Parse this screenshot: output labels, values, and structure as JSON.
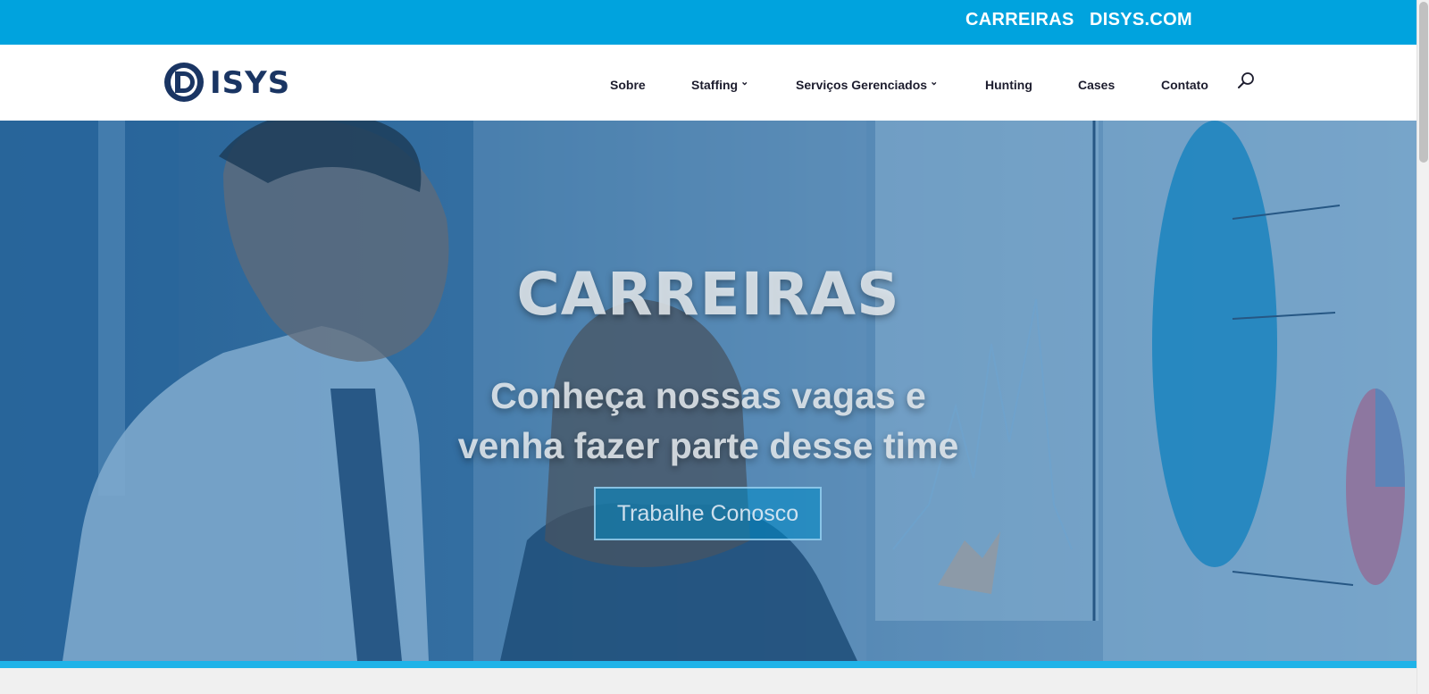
{
  "topbar": {
    "links": [
      "CARREIRAS",
      "DISYS.COM"
    ],
    "color": "#00a3de"
  },
  "header": {
    "logo_text": "DISYS",
    "nav": [
      {
        "label": "Sobre",
        "has_dropdown": false
      },
      {
        "label": "Staffing",
        "has_dropdown": true
      },
      {
        "label": "Serviços Gerenciados",
        "has_dropdown": true
      },
      {
        "label": "Hunting",
        "has_dropdown": false
      },
      {
        "label": "Cases",
        "has_dropdown": false
      },
      {
        "label": "Contato",
        "has_dropdown": false
      }
    ],
    "search_icon": "search-icon",
    "chevron": "⌄"
  },
  "hero": {
    "title": "CARREIRAS",
    "subtitle_line1": "Conheça nossas vagas e",
    "subtitle_line2": "venha fazer parte desse time",
    "button_label": "Trabalhe Conosco"
  },
  "colors": {
    "brand_blue": "#00a3de",
    "logo_navy": "#1a3563",
    "strip": "#1fb3e8"
  }
}
